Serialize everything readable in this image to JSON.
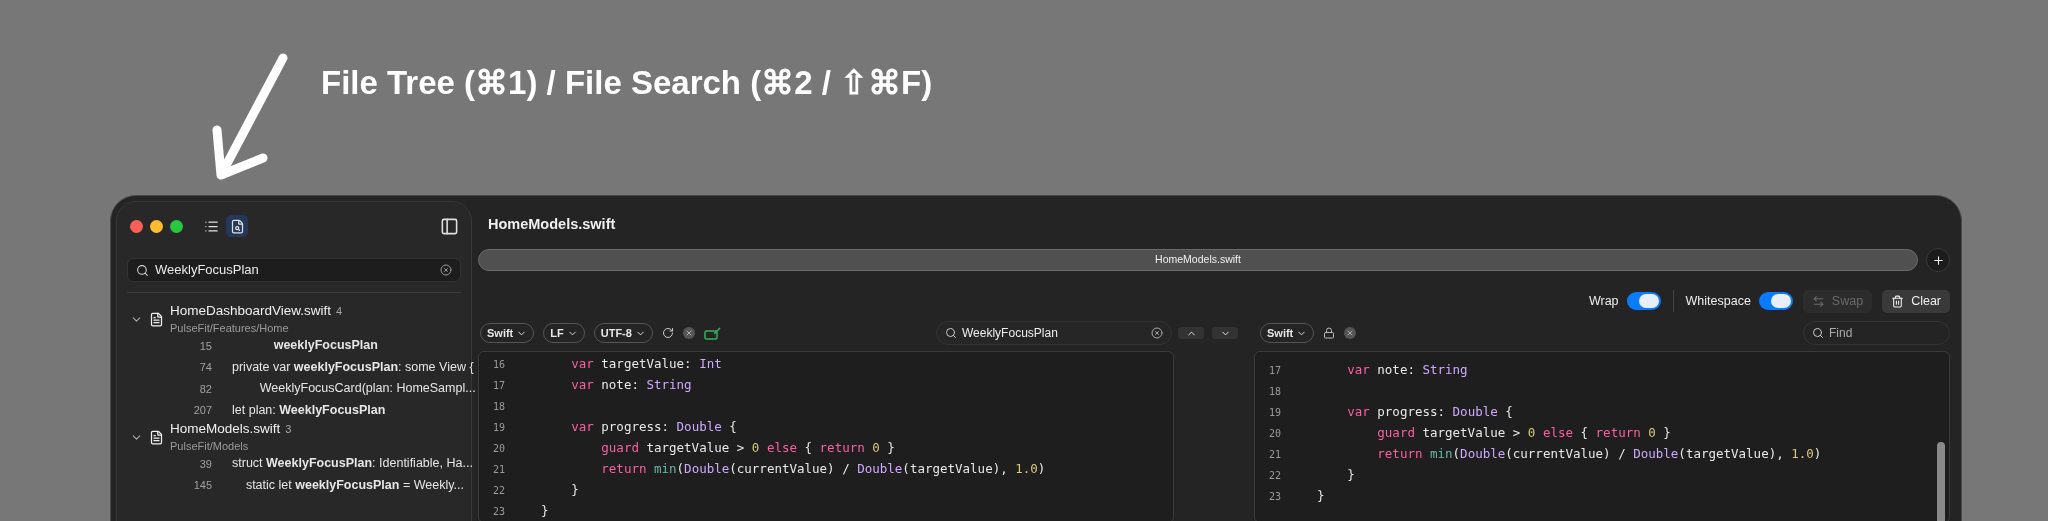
{
  "annotation": {
    "title": "File Tree (⌘1) / File Search (⌘2 / ⇧⌘F)"
  },
  "sidebar": {
    "modes": [
      {
        "kind": "tree",
        "selected": false
      },
      {
        "kind": "search",
        "selected": true
      }
    ],
    "search": {
      "value": "WeeklyFocusPlan"
    },
    "results": [
      {
        "file": "HomeDashboardView.swift",
        "count": "4",
        "path": "PulseFit/Features/Home",
        "expanded": true,
        "matches": [
          {
            "line": "15",
            "text": "            **weeklyFocusPlan**"
          },
          {
            "line": "74",
            "text": "private var **weeklyFocusPlan**: some View {"
          },
          {
            "line": "82",
            "text": "        WeeklyFocusCard(plan: HomeSampl..."
          },
          {
            "line": "207",
            "text": "let plan: **WeeklyFocusPlan**"
          }
        ]
      },
      {
        "file": "HomeModels.swift",
        "count": "3",
        "path": "PulseFit/Models",
        "expanded": true,
        "matches": [
          {
            "line": "39",
            "text": "struct **WeeklyFocusPlan**: Identifiable, Ha..."
          },
          {
            "line": "145",
            "text": "    static let **weeklyFocusPlan** = Weekly..."
          }
        ]
      }
    ]
  },
  "main": {
    "title": "HomeModels.swift",
    "tabs": [
      {
        "label": "HomeModels.swift",
        "selected": true
      }
    ],
    "options": [
      {
        "label": "Wrap",
        "on": true
      },
      {
        "label": "Whitespace",
        "on": true
      }
    ],
    "actions": [
      {
        "kind": "swap",
        "label": "Swap",
        "disabled": true
      },
      {
        "kind": "clear",
        "label": "Clear",
        "disabled": false
      }
    ],
    "left_toolbar": {
      "chips": [
        "Swift",
        "LF",
        "UTF-8"
      ]
    },
    "find": {
      "value": "WeeklyFocusPlan"
    },
    "right_toolbar": {
      "chips": [
        "Swift"
      ],
      "locked": true,
      "find_placeholder": "Find"
    },
    "panes": [
      {
        "lines": [
          {
            "number": "16",
            "tokens": [
              {
                "kind": "keyword",
                "text": "        var"
              },
              {
                "kind": "plain",
                "text": " targetValue: "
              },
              {
                "kind": "type",
                "text": "Int"
              }
            ]
          },
          {
            "number": "17",
            "tokens": [
              {
                "kind": "keyword",
                "text": "        var"
              },
              {
                "kind": "plain",
                "text": " note: "
              },
              {
                "kind": "type",
                "text": "String"
              }
            ]
          },
          {
            "number": "18"
          },
          {
            "number": "19",
            "tokens": [
              {
                "kind": "keyword",
                "text": "        var"
              },
              {
                "kind": "plain",
                "text": " progress: "
              },
              {
                "kind": "type",
                "text": "Double"
              },
              {
                "kind": "plain",
                "text": " {"
              }
            ]
          },
          {
            "number": "20",
            "tokens": [
              {
                "kind": "keyword",
                "text": "            guard"
              },
              {
                "kind": "plain",
                "text": " targetValue > "
              },
              {
                "kind": "number",
                "text": "0"
              },
              {
                "kind": "keyword",
                "text": " else"
              },
              {
                "kind": "plain",
                "text": " { "
              },
              {
                "kind": "keyword",
                "text": "return"
              },
              {
                "kind": "number",
                "text": " 0"
              },
              {
                "kind": "plain",
                "text": " }"
              }
            ]
          },
          {
            "number": "21",
            "tokens": [
              {
                "kind": "keyword",
                "text": "            return"
              },
              {
                "kind": "function",
                "text": " min"
              },
              {
                "kind": "plain",
                "text": "("
              },
              {
                "kind": "type",
                "text": "Double"
              },
              {
                "kind": "plain",
                "text": "(currentValue) / "
              },
              {
                "kind": "type",
                "text": "Double"
              },
              {
                "kind": "plain",
                "text": "(targetValue), "
              },
              {
                "kind": "number",
                "text": "1.0"
              },
              {
                "kind": "plain",
                "text": ")"
              }
            ]
          },
          {
            "number": "22",
            "tokens": [
              {
                "kind": "plain",
                "text": "        }"
              }
            ]
          },
          {
            "number": "23",
            "tokens": [
              {
                "kind": "plain",
                "text": "    }"
              }
            ]
          }
        ]
      },
      {
        "lines": [
          {
            "number": "17",
            "tokens": [
              {
                "kind": "keyword",
                "text": "        var"
              },
              {
                "kind": "plain",
                "text": " note: "
              },
              {
                "kind": "type",
                "text": "String"
              }
            ]
          },
          {
            "number": "18"
          },
          {
            "number": "19",
            "tokens": [
              {
                "kind": "keyword",
                "text": "        var"
              },
              {
                "kind": "plain",
                "text": " progress: "
              },
              {
                "kind": "type",
                "text": "Double"
              },
              {
                "kind": "plain",
                "text": " {"
              }
            ]
          },
          {
            "number": "20",
            "tokens": [
              {
                "kind": "keyword",
                "text": "            guard"
              },
              {
                "kind": "plain",
                "text": " targetValue > "
              },
              {
                "kind": "number",
                "text": "0"
              },
              {
                "kind": "keyword",
                "text": " else"
              },
              {
                "kind": "plain",
                "text": " { "
              },
              {
                "kind": "keyword",
                "text": "return"
              },
              {
                "kind": "number",
                "text": " 0"
              },
              {
                "kind": "plain",
                "text": " }"
              }
            ]
          },
          {
            "number": "21",
            "tokens": [
              {
                "kind": "keyword",
                "text": "            return"
              },
              {
                "kind": "function",
                "text": " min"
              },
              {
                "kind": "plain",
                "text": "("
              },
              {
                "kind": "type",
                "text": "Double"
              },
              {
                "kind": "plain",
                "text": "(currentValue) / "
              },
              {
                "kind": "type",
                "text": "Double"
              },
              {
                "kind": "plain",
                "text": "(targetValue), "
              },
              {
                "kind": "number",
                "text": "1.0"
              },
              {
                "kind": "plain",
                "text": ")"
              }
            ]
          },
          {
            "number": "22",
            "tokens": [
              {
                "kind": "plain",
                "text": "        }"
              }
            ]
          },
          {
            "number": "23",
            "tokens": [
              {
                "kind": "plain",
                "text": "    }"
              }
            ]
          }
        ]
      }
    ]
  }
}
